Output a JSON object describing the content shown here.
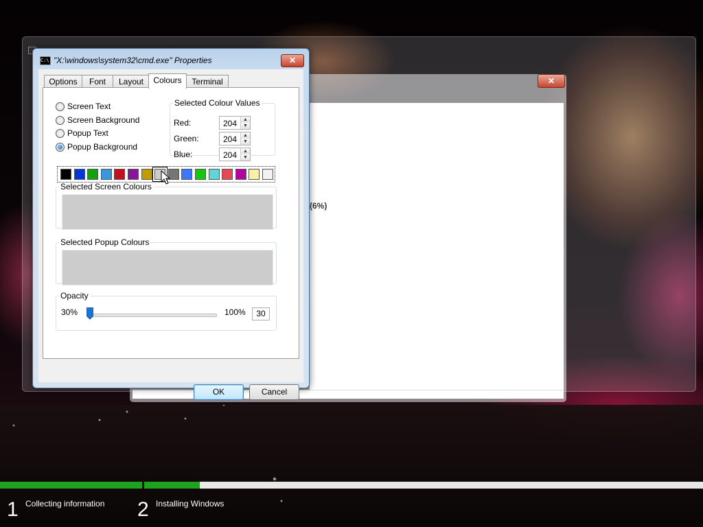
{
  "dialog": {
    "title": "\"X:\\windows\\system32\\cmd.exe\" Properties",
    "close_label": "✕",
    "tabs": [
      {
        "label": "Options",
        "active": false
      },
      {
        "label": "Font",
        "active": false
      },
      {
        "label": "Layout",
        "active": false
      },
      {
        "label": "Colours",
        "active": true
      },
      {
        "label": "Terminal",
        "active": false
      }
    ],
    "radios": [
      {
        "label": "Screen Text",
        "checked": false
      },
      {
        "label": "Screen Background",
        "checked": false
      },
      {
        "label": "Popup Text",
        "checked": false
      },
      {
        "label": "Popup Background",
        "checked": true
      }
    ],
    "selected_values": {
      "legend": "Selected Colour Values",
      "red_label": "Red:",
      "red": "204",
      "green_label": "Green:",
      "green": "204",
      "blue_label": "Blue:",
      "blue": "204"
    },
    "palette": [
      "#000000",
      "#0037da",
      "#13a10e",
      "#3a96dd",
      "#c50f1f",
      "#881798",
      "#c19c00",
      "#cccccc",
      "#767676",
      "#3b78ff",
      "#16c60c",
      "#61d6d6",
      "#e74856",
      "#b4009e",
      "#f9f1a5",
      "#f2f2f2"
    ],
    "palette_selected_index": 7,
    "screen_colours_legend": "Selected Screen Colours",
    "popup_colours_legend": "Selected Popup Colours",
    "preview_color": "#cccccc",
    "opacity": {
      "legend": "Opacity",
      "min_label": "30%",
      "max_label": "100%",
      "value": "30",
      "fraction": 0.0
    },
    "ok_label": "OK",
    "cancel_label": "Cancel"
  },
  "setup": {
    "close_label": "✕",
    "percent_text": "(6%)"
  },
  "progress": {
    "steps": [
      {
        "number": "1",
        "label": "Collecting information",
        "fraction": 1.0
      },
      {
        "number": "2",
        "label": "Installing Windows",
        "fraction": 0.1
      }
    ],
    "fill_color": "#1fa31f"
  },
  "icons": {
    "title_icon": "command-prompt-icon",
    "cursor": "mouse-pointer-icon"
  }
}
